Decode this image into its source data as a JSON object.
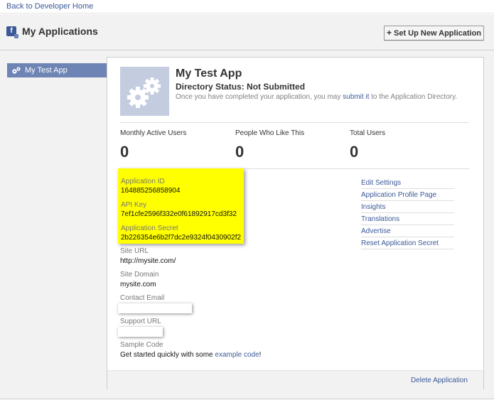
{
  "topbar": {
    "back_link": "Back to Developer Home"
  },
  "header": {
    "title": "My Applications",
    "new_app_button": "Set Up New Application",
    "plus": "+"
  },
  "sidebar": {
    "items": [
      {
        "label": "My Test App",
        "icon": "gears-icon"
      }
    ]
  },
  "app": {
    "name": "My Test App",
    "directory_status_label": "Directory Status:",
    "directory_status_value": "Not Submitted",
    "note_before": "Once you have completed your application, you may",
    "note_link": "submit it",
    "note_after": "to the Application Directory."
  },
  "stats": [
    {
      "label": "Monthly Active Users",
      "value": "0"
    },
    {
      "label": "People Who Like This",
      "value": "0"
    },
    {
      "label": "Total Users",
      "value": "0"
    }
  ],
  "fields": {
    "app_id_label": "Application ID",
    "app_id_value": "164885256858904",
    "api_key_label": "API Key",
    "api_key_value": "7ef1cfe2596f332e0f61892917cd3f32",
    "secret_label": "Application Secret",
    "secret_value": "2b226354e6b2f7dc2e9324f0430902f2",
    "site_url_label": "Site URL",
    "site_url_value": "http://mysite.com/",
    "site_domain_label": "Site Domain",
    "site_domain_value": "mysite.com",
    "contact_email_label": "Contact Email",
    "support_url_label": "Support URL",
    "sample_code_label": "Sample Code",
    "sample_code_before": "Get started quickly with some",
    "sample_code_link": "example code",
    "sample_code_after": "!"
  },
  "actions": [
    "Edit Settings",
    "Application Profile Page",
    "Insights",
    "Translations",
    "Advertise",
    "Reset Application Secret"
  ],
  "footer": {
    "delete_link": "Delete Application"
  },
  "colors": {
    "link": "#3b5998",
    "highlight": "#ffff00",
    "sidebar_selected": "#6d84b4",
    "thumb_bg": "#c4cde0"
  }
}
